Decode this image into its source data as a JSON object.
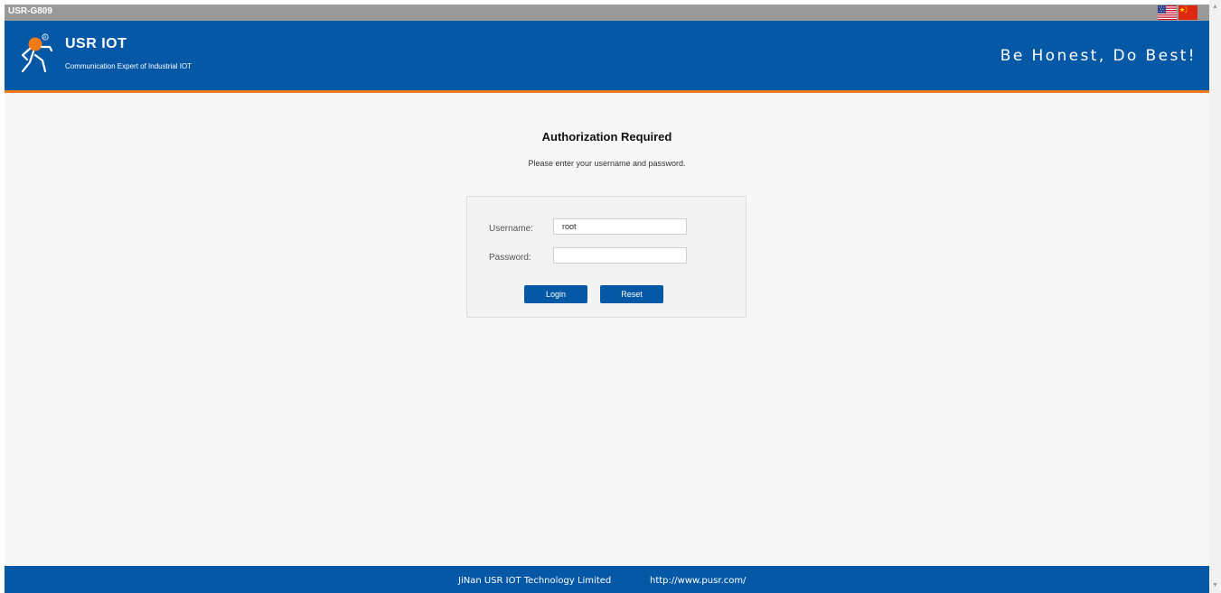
{
  "titlebar": {
    "device_name": "USR-G809",
    "flags": [
      {
        "name": "us-flag-icon",
        "title": "English"
      },
      {
        "name": "cn-flag-icon",
        "title": "Chinese"
      }
    ]
  },
  "header": {
    "brand_name": "USR IOT",
    "brand_sub": "Communication Expert of Industrial IOT",
    "slogan": "Be Honest, Do Best!",
    "colors": {
      "blue": "#0558a6",
      "orange": "#f07b1a"
    }
  },
  "auth": {
    "title": "Authorization Required",
    "message": "Please enter your username and password.",
    "username_label": "Username:",
    "username_value": "root",
    "password_label": "Password:",
    "password_value": "",
    "login_label": "Login",
    "reset_label": "Reset"
  },
  "footer": {
    "company": "JiNan USR IOT Technology Limited",
    "url": "http://www.pusr.com/"
  },
  "scrollbar": {
    "up_icon": "scroll-up-arrow-icon",
    "down_icon": "scroll-down-arrow-icon"
  }
}
